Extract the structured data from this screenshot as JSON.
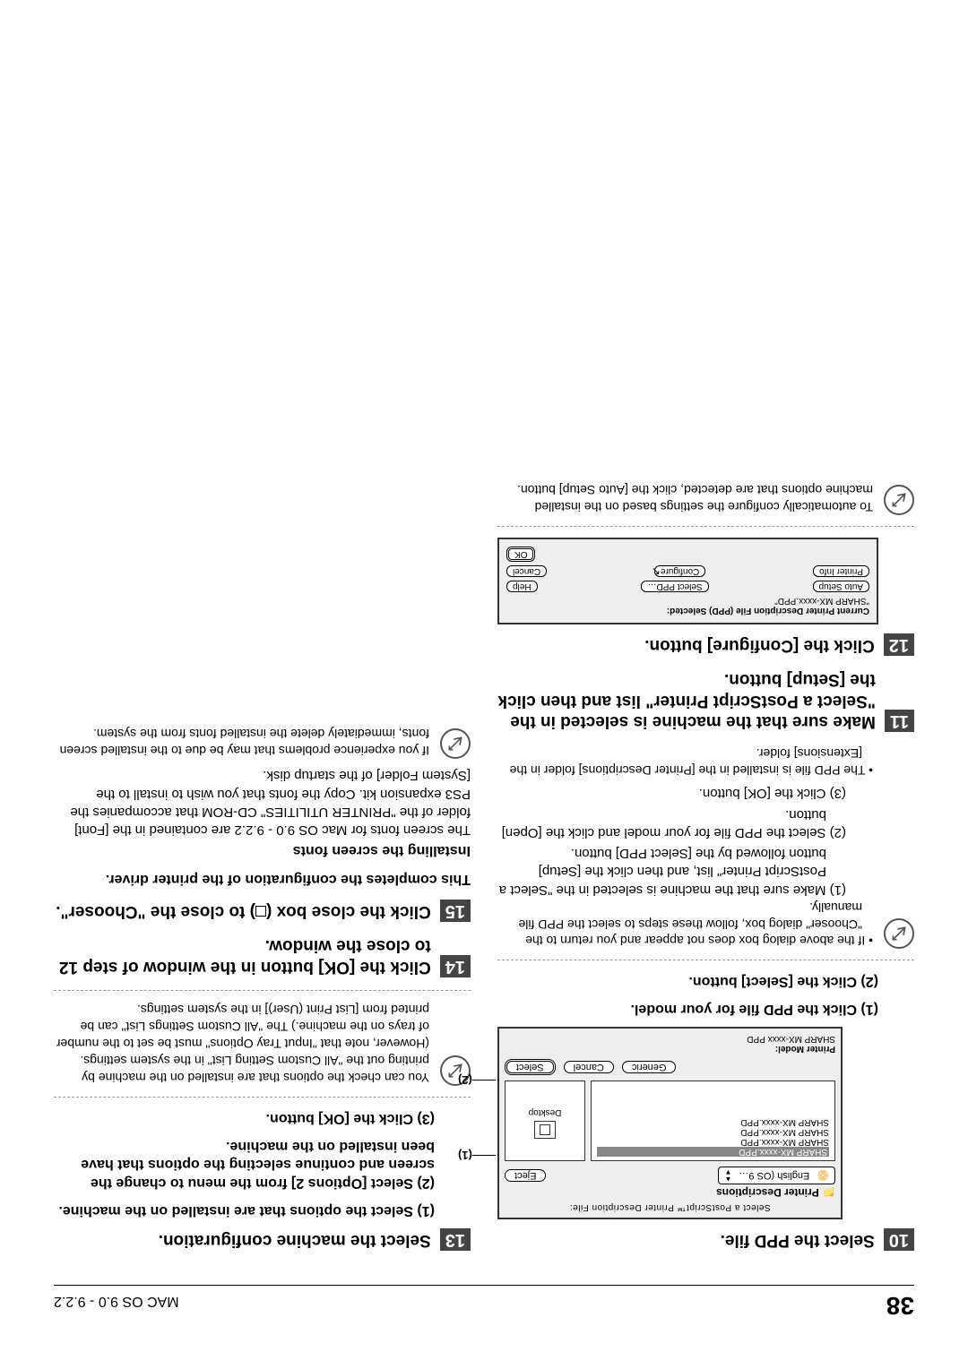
{
  "header": {
    "page_no": "38",
    "section": "MAC OS 9.0 - 9.2.2"
  },
  "left": {
    "s10_no": "10",
    "s10_txt": "Select the PPD file.",
    "sub10_1": "(1) Click the PPD file for your model.",
    "sub10_2": "(2) Click the [Select] button.",
    "d1_titlebar": "Select a PostScript™ Printer Description File:",
    "d1_pdesc": "📁 Printer Descriptions",
    "d1_drop": "English (OS 9…",
    "d1_eject": "Eject",
    "d1_desktop": "Desktop",
    "d1_items": [
      "SHARP MX-xxxx.PPD",
      "SHARP MX-xxxx.PPD",
      "SHARP MX-xxxx.PPD",
      "SHARP MX-xxxx.PPD"
    ],
    "d1_generic": "Generic",
    "d1_cancel": "Cancel",
    "d1_select": "Select",
    "d1_modellabel": "Printer Model:",
    "d1_model": "SHARP MX-xxxx PPD",
    "c1": "(1)",
    "c2": "(2)",
    "note_a": "• If the above dialog box does not appear and you return to the \"Chooser\" dialog box, follow these steps to select the PPD file manually.",
    "note_a1": "(1) Make sure that the machine is selected in the \"Select a PostScript Printer\" list, and then click the [Setup] button followed by the [Select PPD] button.",
    "note_a2": "(2) Select the PPD file for your model and click the [Open] button.",
    "note_a3": "(3) Click the [OK] button.",
    "note_b": "• The PPD file is installed in the [Printer Descriptions] folder in the [Extensions] folder.",
    "s11_no": "11",
    "s11_txt": "Make sure that the machine is selected in the \"Select a PostScript Printer\" list and then click the [Setup] button.",
    "s12_no": "12",
    "s12_txt": "Click the [Configure] button.",
    "d2_l1": "Current Printer Description File (PPD) Selected:",
    "d2_l2": "\"SHARP MX-xxxx.PPD\"",
    "d2_b1": "Auto Setup",
    "d2_b2": "Select PPD…",
    "d2_b3": "Help",
    "d2_b4": "Printer Info",
    "d2_b5": "Configure",
    "d2_b6": "Cancel",
    "d2_b7": "OK",
    "note_c": "To automatically configure the settings based on the installed machine options that are detected, click the [Auto Setup] button."
  },
  "right": {
    "s13_no": "13",
    "s13_txt": "Select the machine configuration.",
    "sub13_1": "(1) Select the options that are installed on the machine.",
    "sub13_2": "(2) Select [Options 2] from the menu to change the screen and continue selecting the options that have been installed on the machine.",
    "sub13_3": "(3) Click the [OK] button.",
    "note_d": "You can check the options that are installed on the machine by printing out the \"All Custom Setting List\" in the system settings. (However, note that \"Input Tray Options\" must be set to the number of trays on the machine.) The \"All Custom Settings List\" can be printed from [List Print (User)] in the system settings.",
    "s14_no": "14",
    "s14_txt": "Click the [OK] button in the window of step 12 to close the window.",
    "s15_no": "15",
    "s15_txt_a": "Click the close box (",
    "s15_txt_b": ") to close the \"Chooser\".",
    "complete": "This completes the configuration of the printer driver.",
    "inst_title": "Installing the screen fonts",
    "inst_body": "The screen fonts for Mac OS 9.0 - 9.2.2 are contained in the [Font] folder of the \"PRINTER UTILITIES\" CD-ROM that accompanies the PS3 expansion kit. Copy the fonts that you wish to install to the [System Folder] of the startup disk.",
    "note_e": "If you experience problems that may be due to the installed screen fonts, immediately delete the installed fonts from the system."
  }
}
